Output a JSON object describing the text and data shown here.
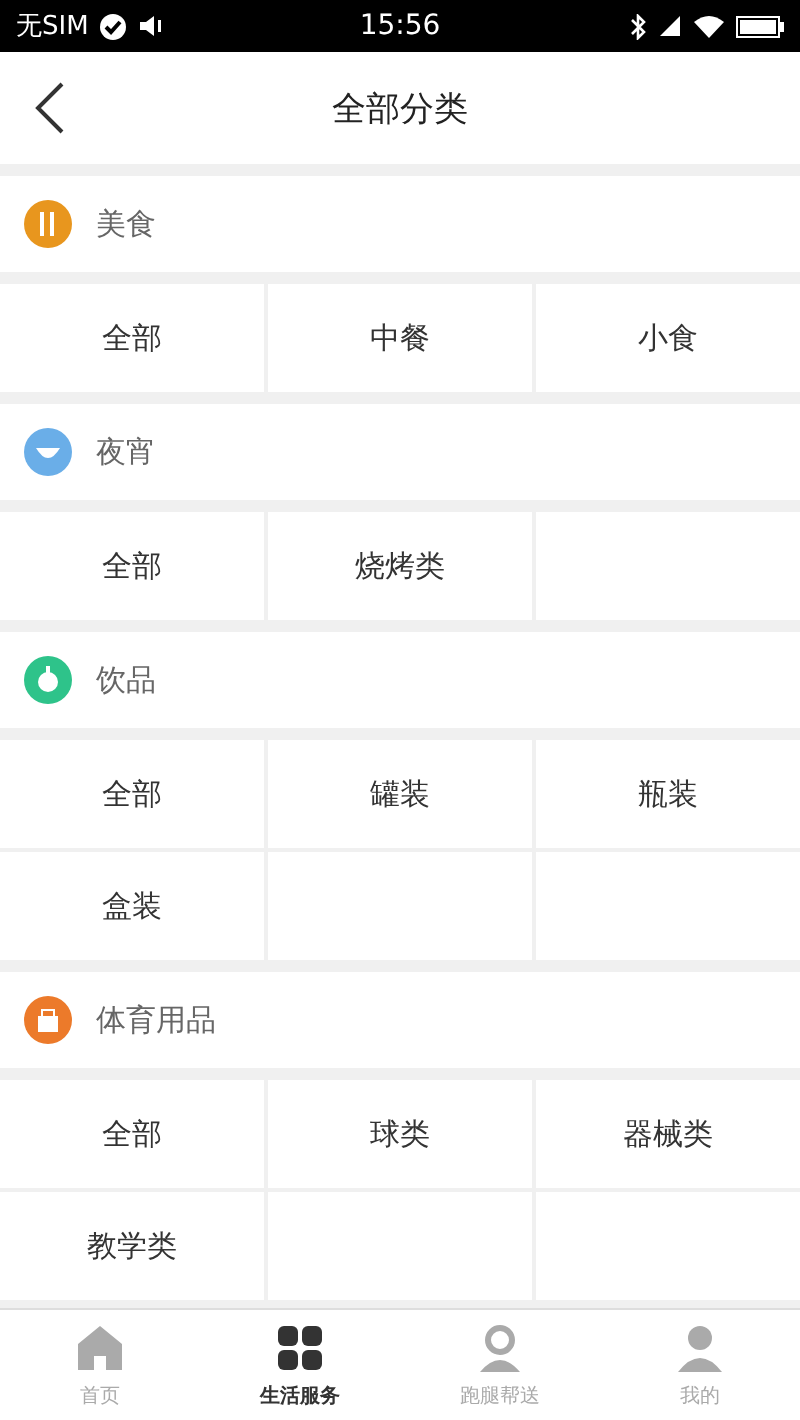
{
  "status_bar": {
    "carrier": "无SIM",
    "time": "15:56"
  },
  "header": {
    "title": "全部分类"
  },
  "sections": [
    {
      "title": "美食",
      "kind": "food",
      "color": "#e8961e",
      "items": [
        "全部",
        "中餐",
        "小食"
      ]
    },
    {
      "title": "夜宵",
      "kind": "night",
      "color": "#6aaee8",
      "items": [
        "全部",
        "烧烤类"
      ]
    },
    {
      "title": "饮品",
      "kind": "drink",
      "color": "#2ec38a",
      "items": [
        "全部",
        "罐装",
        "瓶装",
        "盒装"
      ]
    },
    {
      "title": "体育用品",
      "kind": "sport",
      "color": "#ec7a2a",
      "items": [
        "全部",
        "球类",
        "器械类",
        "教学类"
      ]
    }
  ],
  "tab_bar": [
    {
      "label": "首页",
      "kind": "home",
      "selected": false
    },
    {
      "label": "生活服务",
      "kind": "services",
      "selected": true
    },
    {
      "label": "跑腿帮送",
      "kind": "courier",
      "selected": false
    },
    {
      "label": "我的",
      "kind": "me",
      "selected": false
    }
  ]
}
